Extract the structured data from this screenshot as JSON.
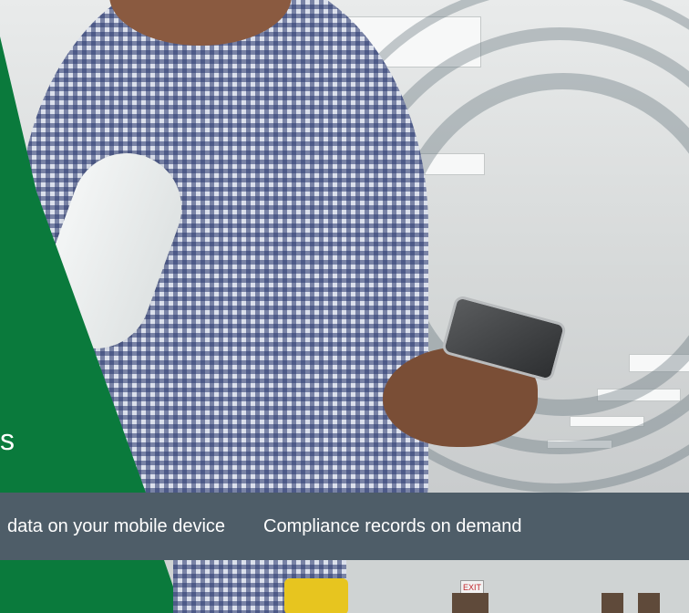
{
  "hero": {
    "green_panel_partial_text": "s"
  },
  "banner": {
    "items": [
      "data on your mobile device",
      "Compliance records on demand"
    ]
  },
  "footer": {
    "exit_sign_text": "EXIT"
  },
  "colors": {
    "brand_green": "#0a7a3c",
    "banner_slate": "#4e5d68",
    "banner_text": "#ffffff"
  },
  "icons": {
    "hero_image": "person-using-smartphone-photo",
    "wifi_rings": "wireless-signal-rings"
  }
}
